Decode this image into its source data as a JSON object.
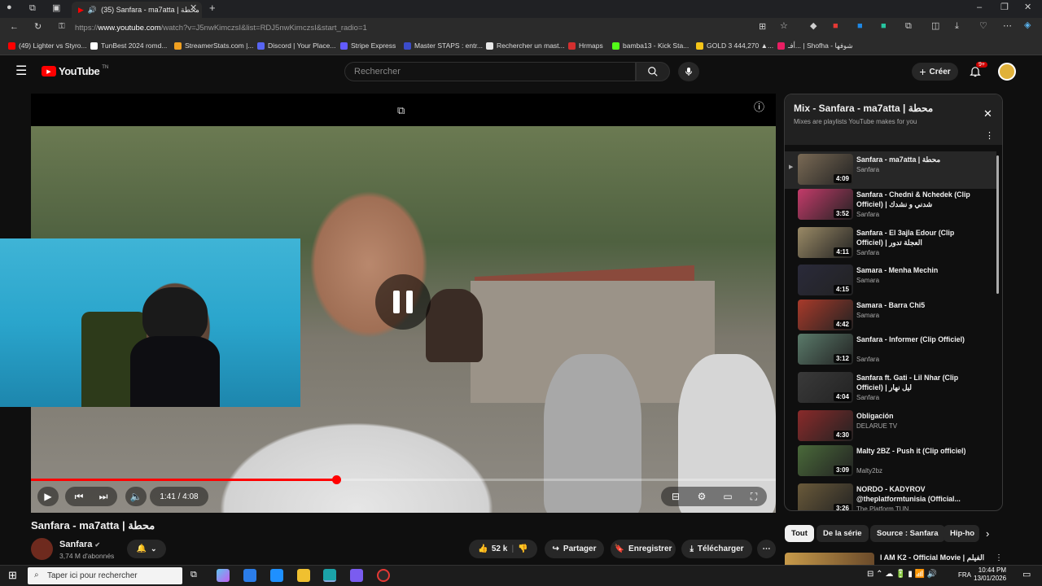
{
  "browser": {
    "tab_title": "(35) Sanfara - ma7atta | محطة",
    "url_prefix": "https://",
    "url_domain": "www.youtube.com",
    "url_path": "/watch?v=J5nwKimczsI&list=RDJ5nwKimczsI&start_radio=1",
    "bookmarks": [
      {
        "label": "(49) Lighter vs Styro...",
        "color": "#ff0000"
      },
      {
        "label": "TunBest 2024 romd...",
        "color": "#ffffff"
      },
      {
        "label": "StreamerStats.com |...",
        "color": "#f0a020"
      },
      {
        "label": "Discord | Your Place...",
        "color": "#5865f2"
      },
      {
        "label": "Stripe Express",
        "color": "#635bff"
      },
      {
        "label": "Master STAPS : entr...",
        "color": "#3b4cca"
      },
      {
        "label": "Rechercher un mast...",
        "color": "#e8e8e8"
      },
      {
        "label": "Hrmaps",
        "color": "#d32f2f"
      },
      {
        "label": "bamba13 - Kick Sta...",
        "color": "#53fc18"
      },
      {
        "label": "GOLD 3 444,270 ▲...",
        "color": "#f5c518"
      },
      {
        "label": "أفـ... | Shofha - شوفها",
        "color": "#e91e63"
      }
    ]
  },
  "header": {
    "logo_text": "YouTube",
    "logo_country": "TN",
    "search_placeholder": "Rechercher",
    "create_label": "Créer",
    "notif_count": "9+"
  },
  "player": {
    "progress": 0.41,
    "time_text": "1:41 / 4:08"
  },
  "video": {
    "title": "Sanfara - ma7atta | محطة",
    "channel": "Sanfara",
    "subscribers": "3,74 M d'abonnés",
    "likes": "52 k",
    "share_label": "Partager",
    "save_label": "Enregistrer",
    "download_label": "Télécharger"
  },
  "playlist": {
    "title": "Mix - Sanfara - ma7atta | محطة",
    "subtitle": "Mixes are playlists YouTube makes for you",
    "items": [
      {
        "title": "Sanfara - ma7atta | محطة",
        "channel": "Sanfara",
        "duration": "4:09",
        "thumb": "#7a6a55"
      },
      {
        "title": "Sanfara - Chedni & Nchedek (Clip Officiel) | شدني و نشدك",
        "channel": "Sanfara",
        "duration": "3:52",
        "thumb": "#c43b6a"
      },
      {
        "title": "Sanfara - El 3ajla Edour (Clip Officiel) | العجلة تدور",
        "channel": "Sanfara",
        "duration": "4:11",
        "thumb": "#9a8a66"
      },
      {
        "title": "Samara - Menha Mechin",
        "channel": "Samara",
        "duration": "4:15",
        "thumb": "#2a2a3a"
      },
      {
        "title": "Samara - Barra Chi5",
        "channel": "Samara",
        "duration": "4:42",
        "thumb": "#a83a2a"
      },
      {
        "title": "Sanfara - Informer (Clip Officiel)",
        "channel": "Sanfara",
        "duration": "3:12",
        "thumb": "#5a7a6a"
      },
      {
        "title": "Sanfara ft. Gati - Lil Nhar (Clip Officiel) | ليل نهار",
        "channel": "Sanfara",
        "duration": "4:04",
        "thumb": "#3a3a3a"
      },
      {
        "title": "Obligación",
        "channel": "DELARUE TV",
        "duration": "4:30",
        "thumb": "#8a2a2a"
      },
      {
        "title": "Malty 2BZ - Push it (Clip officiel)",
        "channel": "Malty2bz",
        "duration": "3:09",
        "thumb": "#4a6a3a"
      },
      {
        "title": "NORDO - KADYROV @theplatformtunisia (Official...",
        "channel": "The Platform TUN",
        "duration": "3:26",
        "thumb": "#6a5a3a"
      }
    ]
  },
  "chips": [
    "Tout",
    "De la série",
    "Source : Sanfara",
    "Hip-ho"
  ],
  "next_up_title": "I AM K2 - Official Movie | الفيلم",
  "taskbar": {
    "search_placeholder": "Taper ici pour rechercher",
    "lang": "FRA",
    "time": "10:44 PM",
    "date": "13/01/2026"
  }
}
